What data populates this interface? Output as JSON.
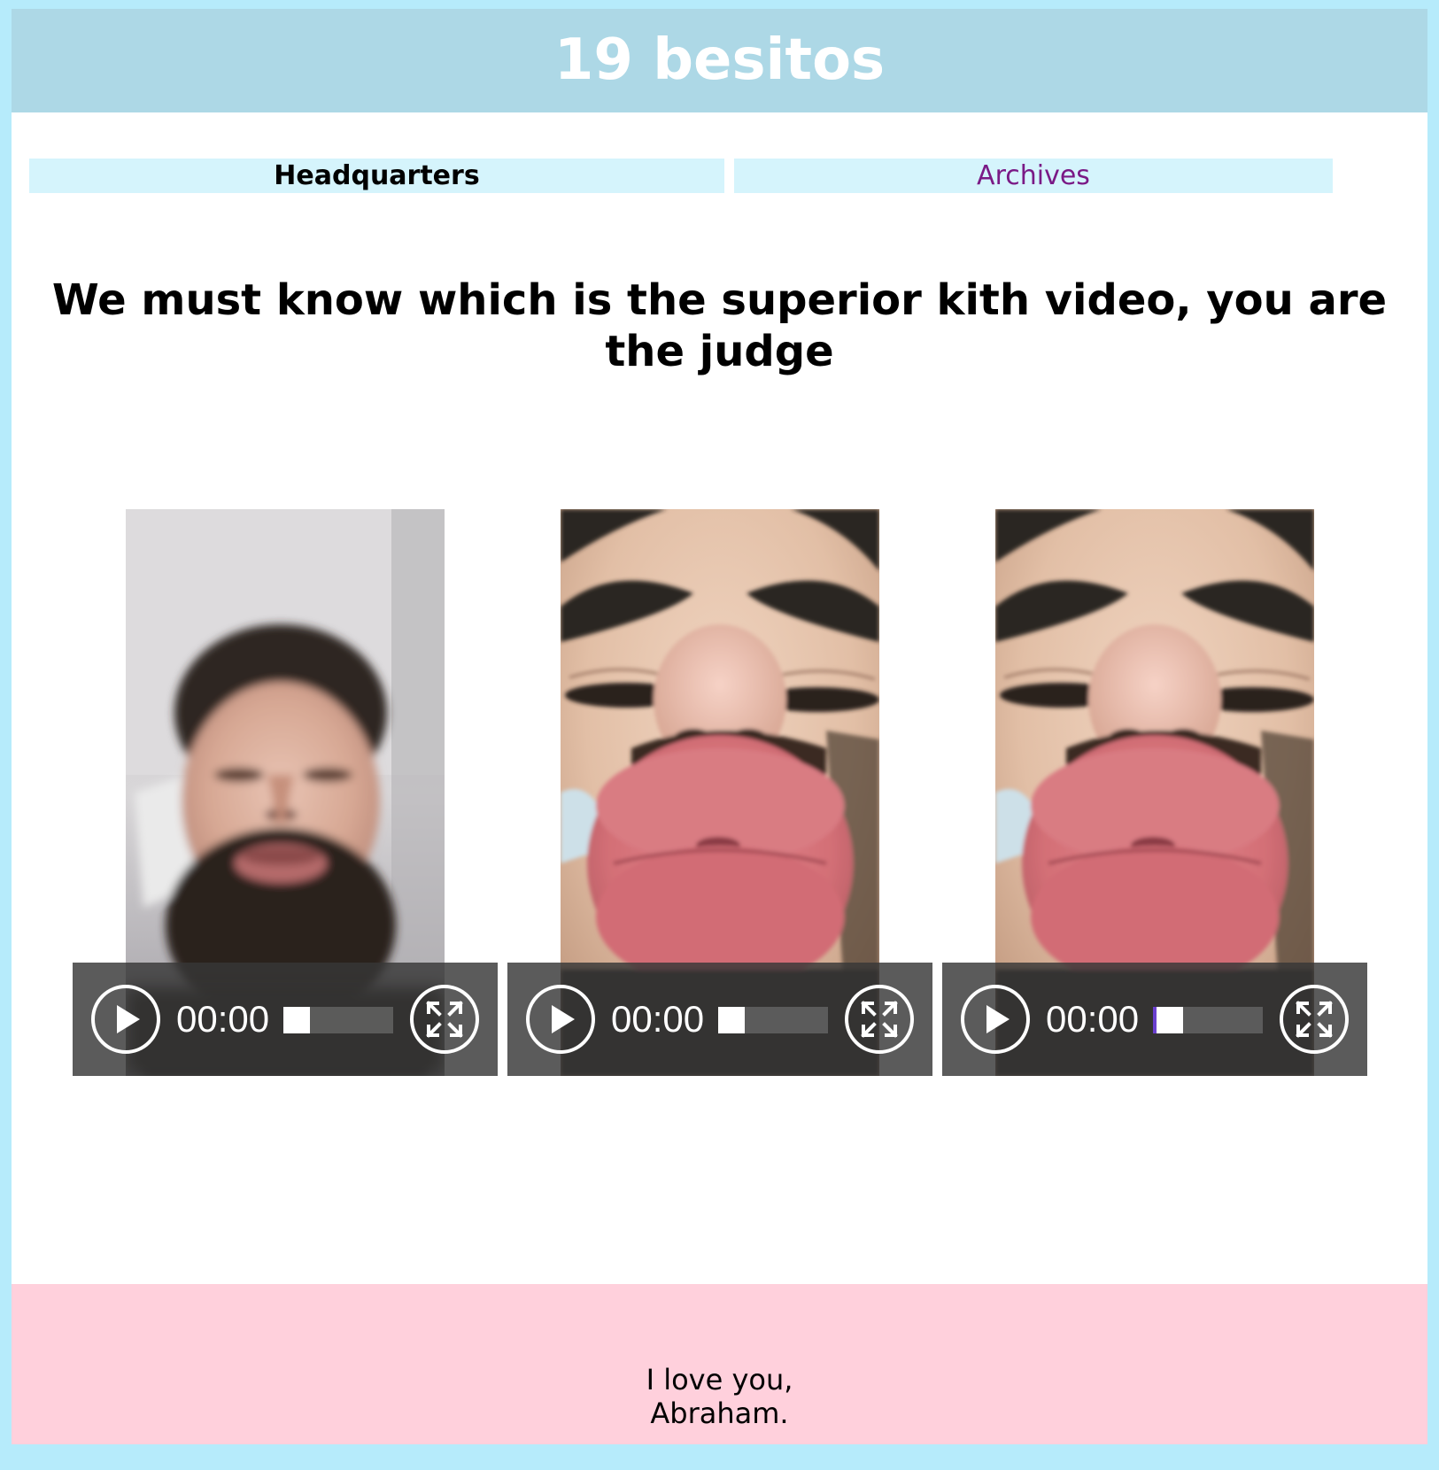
{
  "site": {
    "title": "19 besitos"
  },
  "nav": {
    "items": [
      {
        "label": "Headquarters",
        "active": true
      },
      {
        "label": "Archives",
        "active": false
      }
    ]
  },
  "main": {
    "question": "We must know which is the superior kith video, you are the judge",
    "videos": [
      {
        "time": "00:00",
        "progress": 0,
        "subject": "bearded-face-blurry"
      },
      {
        "time": "00:00",
        "progress": 0,
        "subject": "kissing-lips-closeup"
      },
      {
        "time": "00:00",
        "progress": 0.01,
        "subject": "kissing-lips-closeup"
      }
    ]
  },
  "footer": {
    "line1": "I love you,",
    "line2": "Abraham."
  },
  "colors": {
    "header_bg": "#add8e6",
    "nav_bg": "#d5f4fc",
    "nav_visited_link": "#7a1a86",
    "footer_bg": "#ffd0dc",
    "outer_bg": "#b6ebfb",
    "progress_accent": "#6a3fcf"
  },
  "icons": {
    "play": "play-icon",
    "fullscreen": "fullscreen-icon"
  }
}
